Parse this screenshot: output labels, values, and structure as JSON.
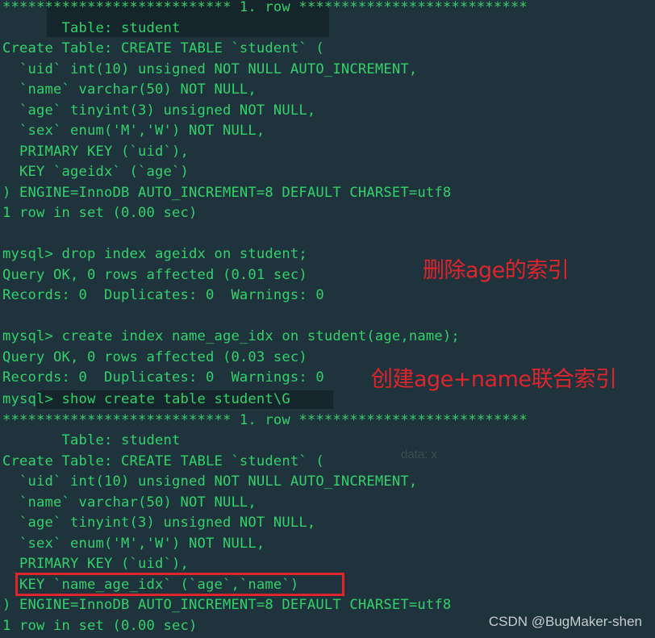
{
  "terminal": {
    "lines": [
      "*************************** 1. row ***************************",
      "       Table: student",
      "Create Table: CREATE TABLE `student` (",
      "  `uid` int(10) unsigned NOT NULL AUTO_INCREMENT,",
      "  `name` varchar(50) NOT NULL,",
      "  `age` tinyint(3) unsigned NOT NULL,",
      "  `sex` enum('M','W') NOT NULL,",
      "  PRIMARY KEY (`uid`),",
      "  KEY `ageidx` (`age`)",
      ") ENGINE=InnoDB AUTO_INCREMENT=8 DEFAULT CHARSET=utf8",
      "1 row in set (0.00 sec)",
      "",
      "mysql> drop index ageidx on student;",
      "Query OK, 0 rows affected (0.01 sec)",
      "Records: 0  Duplicates: 0  Warnings: 0",
      "",
      "mysql> create index name_age_idx on student(age,name);",
      "Query OK, 0 rows affected (0.03 sec)",
      "Records: 0  Duplicates: 0  Warnings: 0",
      "mysql> show create table student\\G",
      "*************************** 1. row ***************************",
      "       Table: student",
      "Create Table: CREATE TABLE `student` (",
      "  `uid` int(10) unsigned NOT NULL AUTO_INCREMENT,",
      "  `name` varchar(50) NOT NULL,",
      "  `age` tinyint(3) unsigned NOT NULL,",
      "  `sex` enum('M','W') NOT NULL,",
      "  PRIMARY KEY (`uid`),",
      "  KEY `name_age_idx` (`age`,`name`)",
      ") ENGINE=InnoDB AUTO_INCREMENT=8 DEFAULT CHARSET=utf8",
      "1 row in set (0.00 sec)"
    ]
  },
  "annotations": {
    "drop_note": "删除age的索引",
    "create_note": "创建age+name联合索引"
  },
  "ghost": {
    "data_label": "data:  x"
  },
  "watermark": "CSDN @BugMaker-shen",
  "colors": {
    "background": "#1f333d",
    "terminal_text": "#33d16a",
    "annotation": "#e0242c"
  }
}
